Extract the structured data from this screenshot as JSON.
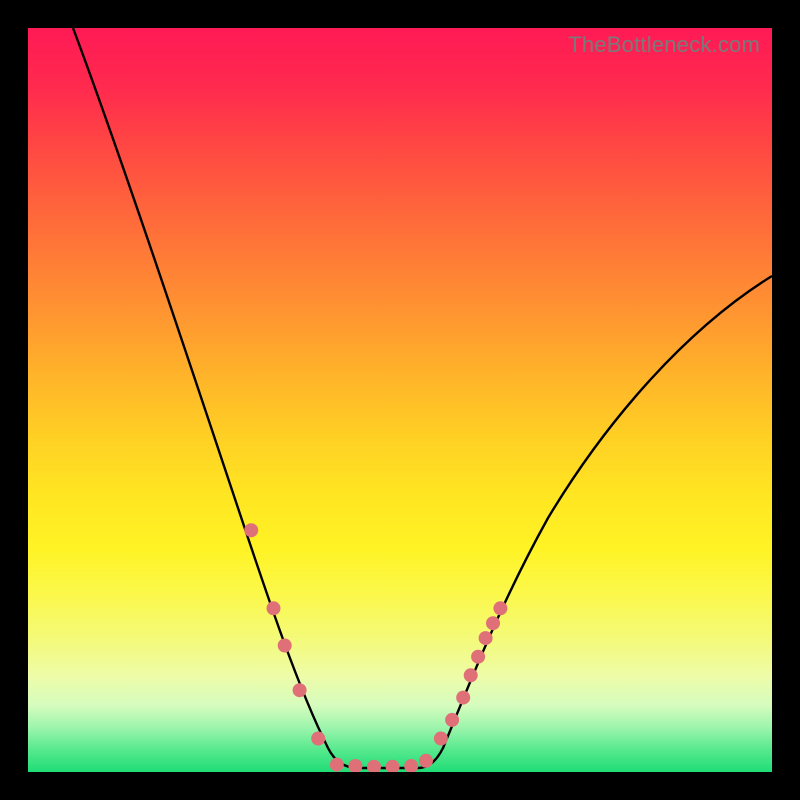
{
  "watermark": "TheBottleneck.com",
  "chart_data": {
    "type": "line",
    "title": "",
    "xlabel": "",
    "ylabel": "",
    "xlim": [
      0,
      100
    ],
    "ylim": [
      0,
      100
    ],
    "series": [
      {
        "name": "left-branch",
        "x": [
          6,
          10,
          15,
          20,
          25,
          30,
          33,
          36,
          39,
          41
        ],
        "y": [
          100,
          92,
          80,
          66,
          50,
          33,
          22,
          12,
          4,
          0
        ]
      },
      {
        "name": "valley-floor",
        "x": [
          41,
          44,
          47,
          50,
          53
        ],
        "y": [
          0,
          0,
          0,
          0,
          0
        ]
      },
      {
        "name": "right-branch",
        "x": [
          53,
          56,
          60,
          65,
          72,
          80,
          88,
          95,
          100
        ],
        "y": [
          0,
          4,
          10,
          18,
          28,
          38,
          46,
          52,
          56
        ]
      }
    ],
    "markers": [
      {
        "x": 30.0,
        "y": 32.5
      },
      {
        "x": 33.0,
        "y": 22.0
      },
      {
        "x": 34.5,
        "y": 17.0
      },
      {
        "x": 36.5,
        "y": 11.0
      },
      {
        "x": 39.0,
        "y": 4.5
      },
      {
        "x": 41.5,
        "y": 1.0
      },
      {
        "x": 44.0,
        "y": 0.8
      },
      {
        "x": 46.5,
        "y": 0.7
      },
      {
        "x": 49.0,
        "y": 0.7
      },
      {
        "x": 51.5,
        "y": 0.8
      },
      {
        "x": 53.5,
        "y": 1.5
      },
      {
        "x": 55.5,
        "y": 4.5
      },
      {
        "x": 57.0,
        "y": 7.0
      },
      {
        "x": 58.5,
        "y": 10.0
      },
      {
        "x": 59.5,
        "y": 13.0
      },
      {
        "x": 60.5,
        "y": 15.5
      },
      {
        "x": 61.5,
        "y": 18.0
      },
      {
        "x": 62.5,
        "y": 20.0
      },
      {
        "x": 63.5,
        "y": 22.0
      }
    ],
    "gradient_stops": [
      {
        "pos": 0,
        "color": "#ff1a55"
      },
      {
        "pos": 50,
        "color": "#ffd024"
      },
      {
        "pos": 100,
        "color": "#1fdd76"
      }
    ]
  }
}
